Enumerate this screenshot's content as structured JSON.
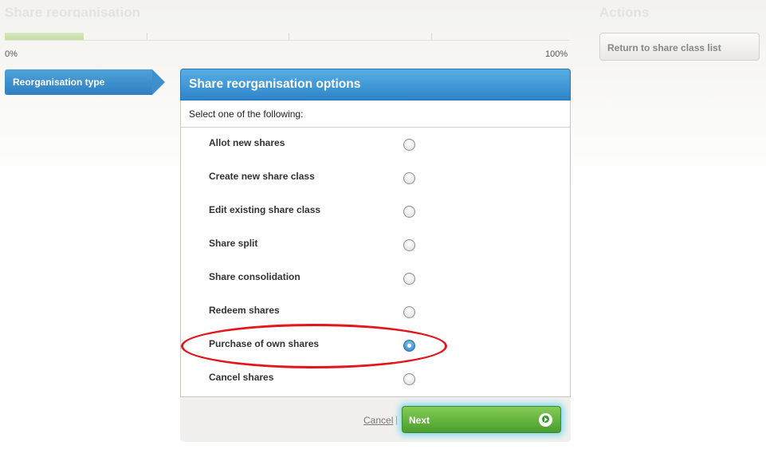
{
  "page": {
    "heading": "Share reorganisation",
    "actions_heading": "Actions"
  },
  "progress": {
    "value_percent": 14,
    "min_label": "0%",
    "max_label": "100%"
  },
  "steps": [
    {
      "label": "Reorganisation type",
      "active": true
    }
  ],
  "panel": {
    "title": "Share reorganisation options",
    "instruction": "Select one of the following:",
    "options": [
      {
        "label": "Allot new shares",
        "selected": false
      },
      {
        "label": "Create new share class",
        "selected": false
      },
      {
        "label": "Edit existing share class",
        "selected": false
      },
      {
        "label": "Share split",
        "selected": false
      },
      {
        "label": "Share consolidation",
        "selected": false
      },
      {
        "label": "Redeem shares",
        "selected": false
      },
      {
        "label": "Purchase of own shares",
        "selected": true
      },
      {
        "label": "Cancel shares",
        "selected": false
      }
    ]
  },
  "footer": {
    "cancel_label": "Cancel",
    "separator": "|",
    "next_label": "Next"
  },
  "sidebar": {
    "return_button_label": "Return to share class list"
  },
  "colors": {
    "primary_blue": "#2f84c9",
    "next_green": "#4a9e2d",
    "highlight_red": "#e3161b",
    "progress_green": "#c3dea2"
  }
}
